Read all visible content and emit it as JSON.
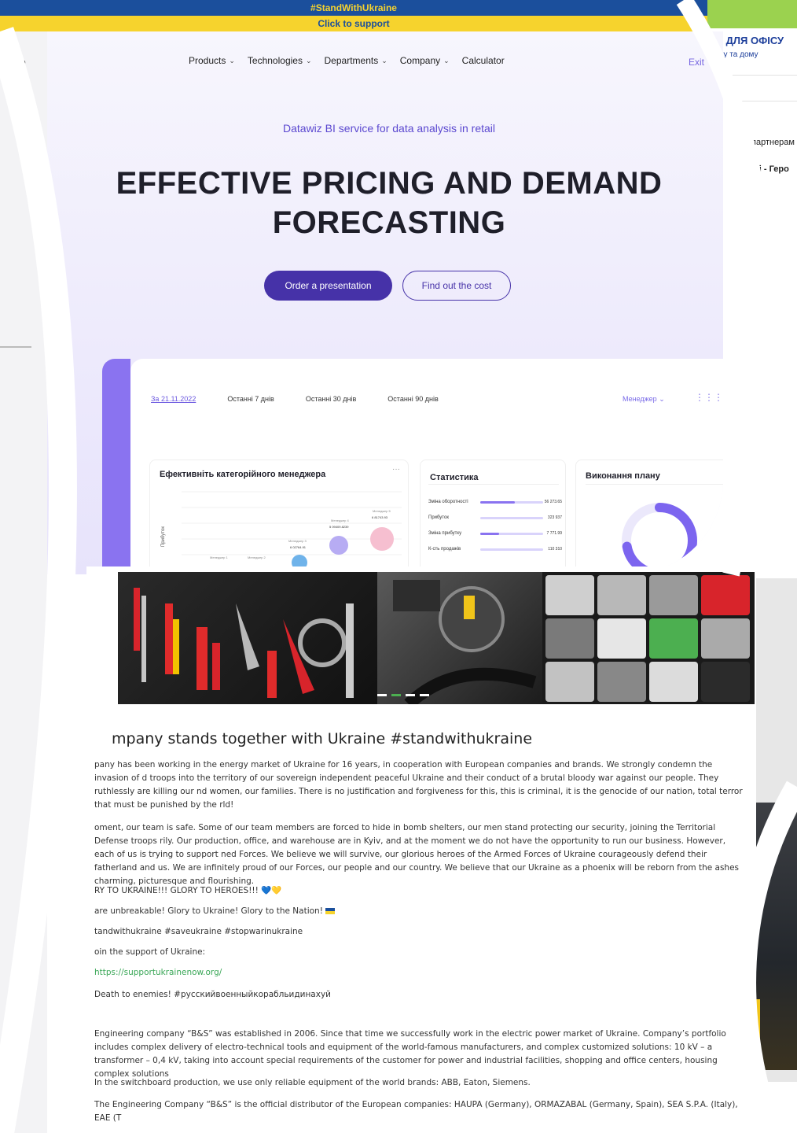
{
  "ukraine_banner": {
    "hashtag": "#StandWithUkraine",
    "support": "Click to support"
  },
  "left_fragment": {
    "letter": "o"
  },
  "right_fragment": {
    "title": "СЕ ДЛЯ ОФІСУ",
    "subtitle": "есу та дому",
    "partners": "партнерам",
    "heroes": "їні - Геро"
  },
  "datawiz": {
    "nav": [
      "Products",
      "Technologies",
      "Departments",
      "Company",
      "Calculator"
    ],
    "exit": "Exit",
    "tagline": "Datawiz BI service for data analysis in retail",
    "title": "EFFECTIVE PRICING AND DEMAND FORECASTING",
    "order_button": "Order a presentation",
    "cost_button": "Find out the cost",
    "dashboard": {
      "tabs": [
        "За 21.11.2022",
        "Останні 7 днів",
        "Останні 30 днів",
        "Останні 90 днів"
      ],
      "manager": "Менеджер",
      "card1_title": "Ефективніть категорійного менеджера",
      "card2_title": "Статистика",
      "card3_title": "Виконання плану",
      "y_label": "Прибуток",
      "managers": [
        {
          "name": "Менеджер 1",
          "value": ""
        },
        {
          "name": "Менеджер 2",
          "value": ""
        },
        {
          "name": "Менеджер 3",
          "value": "6 02764.91"
        },
        {
          "name": "Менеджер 4",
          "value": "5 09409.8239"
        },
        {
          "name": "Менеджер 5",
          "value": "6 81743.93"
        }
      ],
      "stats": [
        {
          "label": "Зміна оборотності",
          "value": "56 273.65",
          "fill": 0.55
        },
        {
          "label": "Прибуток",
          "value": "323 937",
          "fill": 0.0
        },
        {
          "label": "Зміна прибутку",
          "value": "7 771.99",
          "fill": 0.3
        },
        {
          "label": "К-сть продажів",
          "value": "110 310",
          "fill": 0.0
        }
      ],
      "plan_fill": 0.72
    }
  },
  "bs": {
    "heading": "mpany stands together with Ukraine #standwithukraine",
    "para1": "pany has been working in the energy market of Ukraine for 16 years, in cooperation with European companies and brands. We strongly condemn the invasion of d troops into the territory of our sovereign independent peaceful Ukraine and their conduct of a brutal bloody war against our people. They ruthlessly are killing our nd women, our families. There is no justification and forgiveness for this, this is criminal, it is the genocide of our nation, total terror that must be punished by the rld!",
    "para2": "oment, our team is safe. Some of our team members are forced to hide in bomb shelters, our men stand protecting our security, joining the Territorial Defense troops rily. Our production, office, and warehouse are in Kyiv, and at the moment we do not have the opportunity to run our business. However, each of us is trying to support ned Forces. We believe we will survive, our glorious heroes of the Armed Forces of Ukraine courageously defend their fatherland and us. We are infinitely proud of our Forces, our people and our country. We believe that our Ukraine as a phoenix will be reborn from the ashes charming, picturesque and flourishing.",
    "glory": "RY TO UKRAINE!!! GLORY TO HEROES!!! 💙💛",
    "unbreakable": "are unbreakable! Glory to Ukraine! Glory to the Nation!",
    "hashtags": "tandwithukraine #saveukraine #stopwarinukraine",
    "join": "oin the support of Ukraine:",
    "link": "https://supportukrainenow.org/",
    "death": "Death to enemies! #русскийвоенныйкорабльидинахуй",
    "para3": "Engineering company “B&S” was established in 2006. Since that time we successfully work in the electric power market of Ukraine. Company’s portfolio includes complex delivery of electro-technical tools and equipment of the world-famous manufacturers, and complex customized solutions: 10 kV – a transformer – 0,4 kV, taking into account special requirements of the customer for power and industrial facilities, shopping and office centers, housing complex solutions",
    "para4": "In the switchboard production, we use only reliable equipment of the world brands: ABB, Eaton, Siemens.",
    "para5": "The Engineering Company “B&S” is the official distributor of the European companies: HAUPA (Germany), ORMAZABAL (Germany, Spain), SEA S.P.A. (Italy), EAE (T"
  },
  "colors": {
    "brand_purple": "#4632a8",
    "accent_violet": "#8a73f0",
    "ua_blue": "#1b4f9c",
    "ua_yellow": "#f6d32d",
    "link_green": "#3aa757"
  }
}
